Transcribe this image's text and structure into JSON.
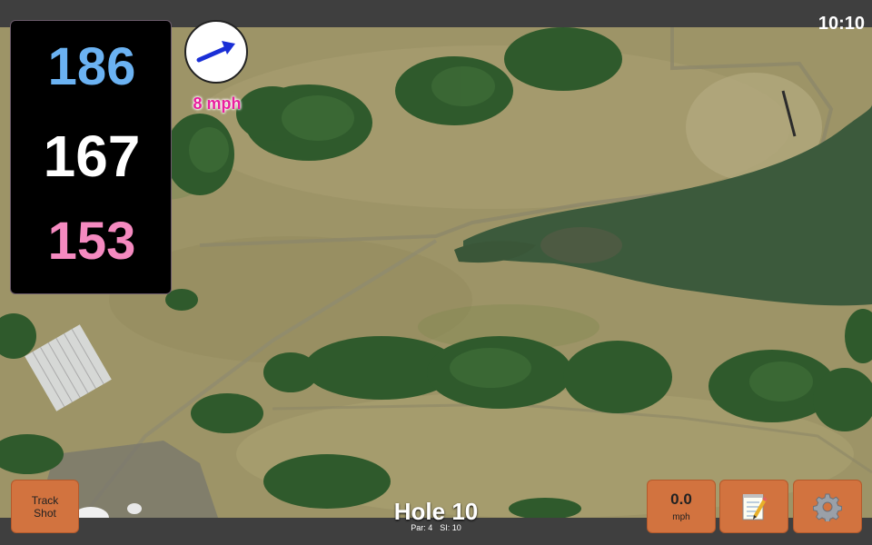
{
  "status": {
    "time": "10:10"
  },
  "distances": {
    "back": "186",
    "middle": "167",
    "front": "153"
  },
  "wind": {
    "speed": "8 mph",
    "direction_icon": "arrow-icon",
    "arrow_color": "#1a2fd6"
  },
  "hole": {
    "title": "Hole 10",
    "par": "Par: 4",
    "si": "SI: 10"
  },
  "buttons": {
    "track_shot": {
      "line1": "Track",
      "line2": "Shot"
    },
    "speed": {
      "value": "0.0",
      "unit": "mph"
    },
    "notes": {
      "icon": "notepad-icon"
    },
    "settings": {
      "icon": "gear-icon"
    }
  },
  "colors": {
    "back_distance": "#6bb2f2",
    "middle_distance": "#ffffff",
    "front_distance": "#f58ac0",
    "button_bg": "#d2733f",
    "wind_text": "#e91e9e"
  }
}
